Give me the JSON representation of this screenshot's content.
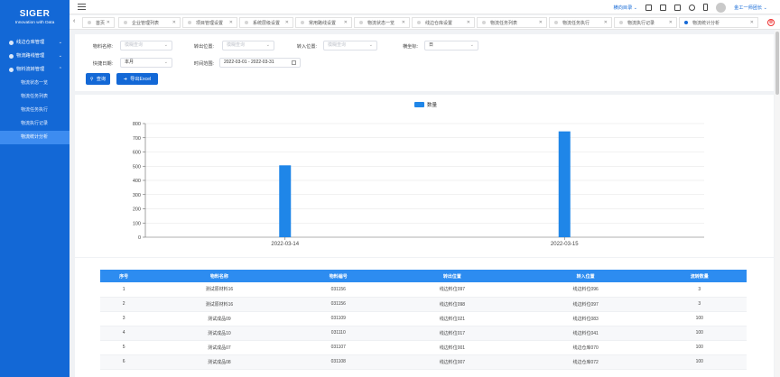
{
  "brand": {
    "name": "SIGER",
    "tagline": "Innovation with Data"
  },
  "sidebar": {
    "groups": [
      {
        "label": "线边仓库管理",
        "arrow": "⌄"
      },
      {
        "label": "物流路线管理",
        "arrow": "⌄"
      },
      {
        "label": "物料流转管理",
        "arrow": "⌃"
      }
    ],
    "sub_items": [
      {
        "label": "物流状态一览"
      },
      {
        "label": "物流任务列表"
      },
      {
        "label": "物流任务执行"
      },
      {
        "label": "物流执行记录"
      },
      {
        "label": "物流统计分析"
      }
    ]
  },
  "header": {
    "dir_label": "横向目录 ⌄",
    "user": "金工一师团长 ⌄"
  },
  "tabs": [
    {
      "label": "首页"
    },
    {
      "label": "企业管理列表"
    },
    {
      "label": "项目管理设置"
    },
    {
      "label": "系统层级设置"
    },
    {
      "label": "常用路线设置"
    },
    {
      "label": "物流状态一览"
    },
    {
      "label": "线边仓库设置"
    },
    {
      "label": "物流任务列表"
    },
    {
      "label": "物流任务执行"
    },
    {
      "label": "物流执行记录"
    },
    {
      "label": "物流统计分析"
    }
  ],
  "filters": {
    "material_name": {
      "label": "物料名称:",
      "placeholder": "模糊查询"
    },
    "out_location": {
      "label": "转出位置:",
      "placeholder": "模糊查询"
    },
    "in_location": {
      "label": "转入位置:",
      "placeholder": "模糊查询"
    },
    "axis": {
      "label": "横坐标:",
      "value": "日"
    },
    "quick_date": {
      "label": "快捷日期:",
      "value": "本月"
    },
    "time_range": {
      "label": "时间范围:",
      "value": "2022-03-01 - 2022-03-31"
    },
    "query_button": "查询",
    "export_button": "导出Excel"
  },
  "chart_data": {
    "type": "bar",
    "categories": [
      "2022-03-14",
      "2022-03-15"
    ],
    "series": [
      {
        "name": "数量",
        "values": [
          506,
          745
        ]
      }
    ],
    "ylim": [
      0,
      800
    ],
    "yticks": [
      "0",
      "100",
      "200",
      "300",
      "400",
      "500",
      "600",
      "700",
      "800"
    ],
    "legend": "top-center",
    "grid": true,
    "color": "#1f86e8"
  },
  "table": {
    "headers": [
      "序号",
      "物料名称",
      "物料编号",
      "转出位置",
      "转入位置",
      "流转数量"
    ],
    "rows": [
      [
        "1",
        "测试原材料16",
        "031156",
        "线边料位097",
        "线边料位096",
        "3"
      ],
      [
        "2",
        "测试原材料16",
        "031156",
        "线边料位098",
        "线边料位097",
        "3"
      ],
      [
        "3",
        "测试成品09",
        "031109",
        "线边料位021",
        "线边料位083",
        "100"
      ],
      [
        "4",
        "测试成品10",
        "031110",
        "线边料位017",
        "线边料位041",
        "100"
      ],
      [
        "5",
        "测试成品07",
        "031107",
        "线边料位001",
        "线边仓库070",
        "100"
      ],
      [
        "6",
        "测试成品08",
        "031108",
        "线边料位007",
        "线边仓库072",
        "100"
      ]
    ]
  }
}
